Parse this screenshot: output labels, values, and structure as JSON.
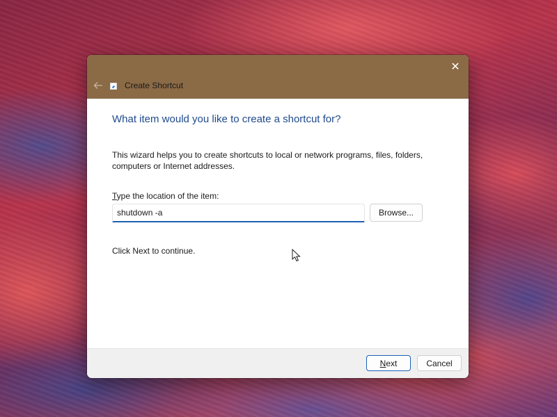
{
  "window": {
    "title": "Create Shortcut",
    "close_glyph": "✕",
    "titlebar_color": "#8b6a46",
    "icons": {
      "back": "back-arrow-icon",
      "app": "shortcut-app-icon",
      "close": "close-icon"
    }
  },
  "wizard": {
    "heading": "What item would you like to create a shortcut for?",
    "description": "This wizard helps you to create shortcuts to local or network programs, files, folders, computers or Internet addresses.",
    "field_label_mnemonic": "T",
    "field_label_rest": "ype the location of the item:",
    "location_value": "shutdown -a",
    "browse_label": "Browse...",
    "continue_text": "Click Next to continue.",
    "heading_color": "#1f4a8c",
    "accent_color": "#1a5fb4"
  },
  "footer": {
    "next_mnemonic": "N",
    "next_rest": "ext",
    "cancel_label": "Cancel"
  }
}
